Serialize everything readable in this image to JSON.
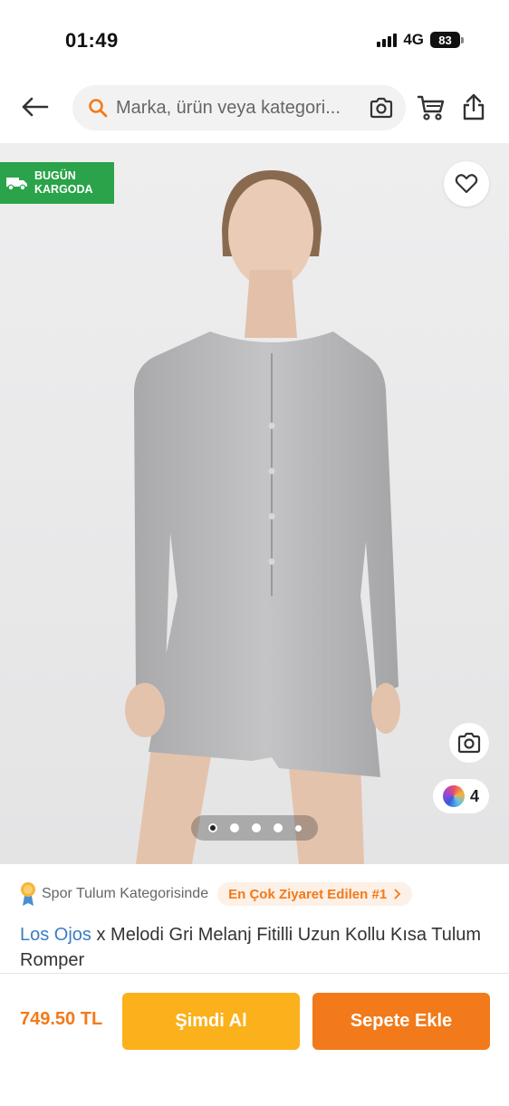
{
  "status_bar": {
    "time": "01:49",
    "network": "4G",
    "battery": "83"
  },
  "header": {
    "search_placeholder": "Marka, ürün veya kategori...",
    "icons": [
      "back-arrow-icon",
      "search-icon",
      "camera-icon",
      "cart-icon",
      "share-icon"
    ]
  },
  "gallery": {
    "shipping_badge": [
      "BUGÜN",
      "KARGODA"
    ],
    "color_count": "4",
    "total_images": 5,
    "active_image": 1
  },
  "product": {
    "category_text": "Spor Tulum Kategorisinde",
    "rank_badge": "En Çok Ziyaret Edilen #1",
    "brand": "Los Ojos",
    "name": " x Melodi Gri Melanj Fitilli Uzun Kollu Kısa Tulum Romper"
  },
  "bottom_bar": {
    "price": "749.50 TL",
    "buy_now": "Şimdi Al",
    "add_to_cart": "Sepete Ekle"
  },
  "colors": {
    "accent": "#f27a1a",
    "buy_now": "#fbb11b",
    "shipping_badge": "#2aa34a",
    "brand_link": "#3d7cc4"
  }
}
